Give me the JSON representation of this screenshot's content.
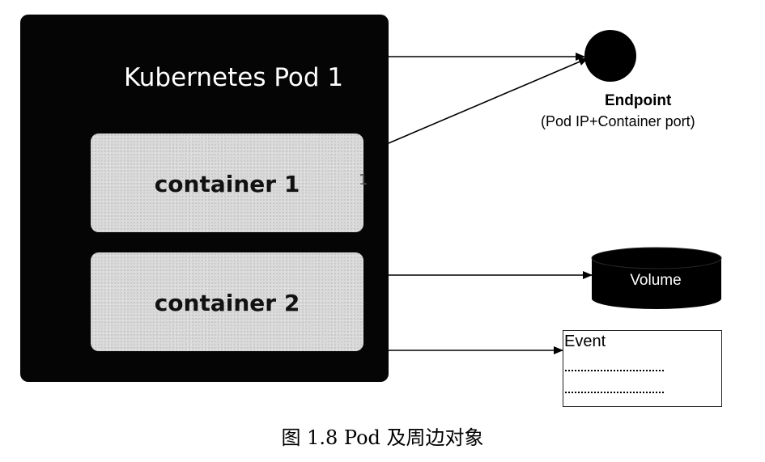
{
  "pod": {
    "title": "Kubernetes Pod 1",
    "containers": [
      {
        "label": "container 1"
      },
      {
        "label": "container 2"
      }
    ],
    "stray_mark": "1"
  },
  "endpoint": {
    "label": "Endpoint",
    "sublabel": "(Pod IP+Container port)"
  },
  "volume": {
    "label": "Volume"
  },
  "event": {
    "label": "Event"
  },
  "caption": "图 1.8   Pod 及周边对象",
  "colors": {
    "pod_background": "#050505",
    "container_fill": "#d9d9d9",
    "shape_fill": "#000000",
    "arrow": "#000000"
  }
}
